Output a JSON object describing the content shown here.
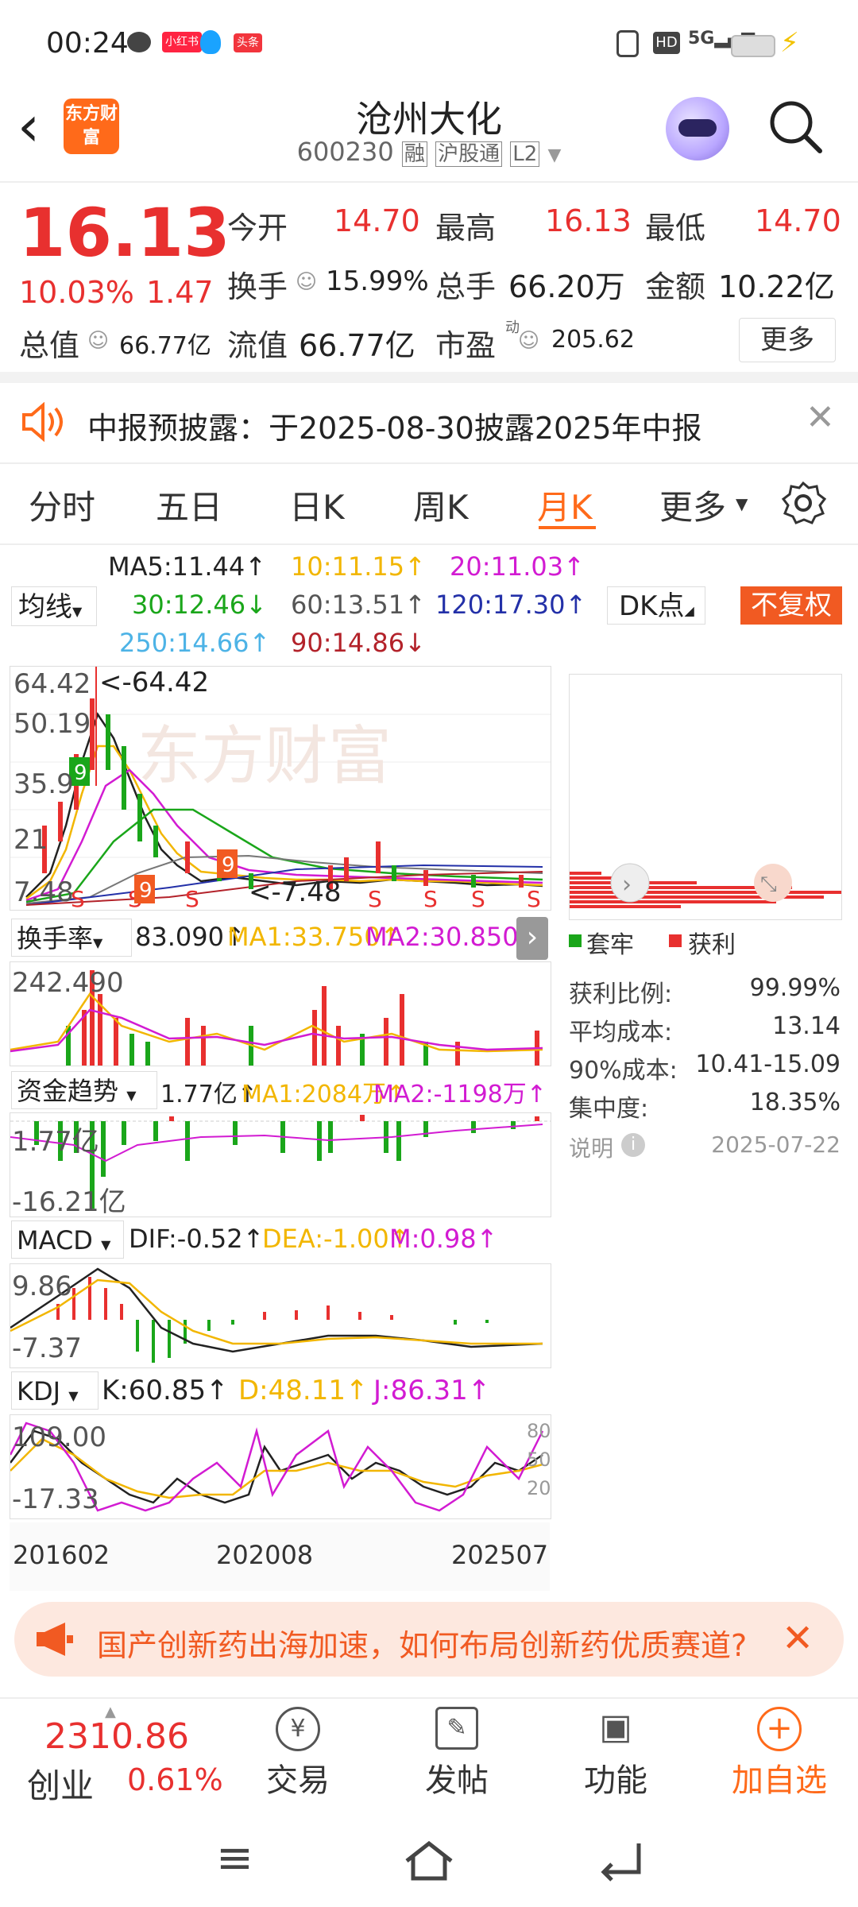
{
  "status": {
    "time": "00:24",
    "app_badges": [
      "小红书",
      "头条"
    ]
  },
  "header": {
    "title": "沧州大化",
    "code": "600230",
    "tags": [
      "融",
      "沪股通",
      "L2"
    ],
    "logo_text": "东方财富"
  },
  "quote": {
    "price": "16.13",
    "change_pct": "10.03%",
    "change": "1.47",
    "rows": [
      [
        {
          "label": "今开",
          "value": "14.70"
        },
        {
          "label": "最高",
          "value": "16.13"
        },
        {
          "label": "最低",
          "value": "14.70"
        }
      ],
      [
        {
          "label": "换手",
          "value": "15.99%"
        },
        {
          "label": "总手",
          "value": "66.20万"
        },
        {
          "label": "金额",
          "value": "10.22亿"
        }
      ],
      [
        {
          "label": "总值",
          "value": "66.77亿"
        },
        {
          "label": "流值",
          "value": "66.77亿"
        },
        {
          "label": "市盈",
          "value": "205.62",
          "sup": "动"
        }
      ]
    ],
    "more_label": "更多"
  },
  "notice": {
    "text": "中报预披露：于2025-08-30披露2025年中报"
  },
  "tabs": {
    "items": [
      "分时",
      "五日",
      "日K",
      "周K",
      "月K",
      "更多"
    ],
    "active": "月K"
  },
  "ma": {
    "selector": "均线",
    "ma5": "MA5:11.44↑",
    "ma10": "10:11.15↑",
    "ma20": "20:11.03↑",
    "ma30": "30:12.46↓",
    "ma60": "60:13.51↑",
    "ma120": "120:17.30↑",
    "ma250": "250:14.66↑",
    "ma90": "90:14.86↓",
    "dk": "DK点",
    "fq": "不复权"
  },
  "kline": {
    "y_top": "64.42",
    "y_2": "50.19",
    "y_3": "35.9",
    "y_4": "21",
    "y_bottom": "7.48",
    "high_mark": "<-64.42",
    "low_mark": "<-7.48"
  },
  "turnover": {
    "selector": "换手率",
    "value": "83.090↑",
    "ma1": "MA1:33.750↑",
    "ma2": "MA2:30.850↑",
    "y_top": "242.490"
  },
  "capital": {
    "selector": "资金趋势",
    "value": "1.77亿↑",
    "ma1": "MA1:2084万↑",
    "ma2": "MA2:-1198万↑",
    "y_top": "1.77亿",
    "y_bottom": "-16.21亿"
  },
  "macd": {
    "selector": "MACD",
    "dif": "DIF:-0.52↑",
    "dea": "DEA:-1.00↑",
    "m": "M:0.98↑",
    "y_top": "9.86",
    "y_bottom": "-7.37"
  },
  "kdj": {
    "selector": "KDJ",
    "k": "K:60.85↑",
    "d": "D:48.11↑",
    "j": "J:86.31↑",
    "y_top": "109.00",
    "y_bottom": "-17.33",
    "r80": "80",
    "r50": "50",
    "r20": "20"
  },
  "xaxis": {
    "left": "201602",
    "mid": "202008",
    "right": "202507"
  },
  "chips": {
    "legend_trapped": "套牢",
    "legend_profit": "获利",
    "rows": [
      {
        "label": "获利比例:",
        "value": "99.99%"
      },
      {
        "label": "平均成本:",
        "value": "13.14"
      },
      {
        "label": "90%成本:",
        "value": "10.41-15.09"
      },
      {
        "label": "集中度:",
        "value": "18.35%"
      }
    ],
    "note_label": "说明",
    "date": "2025-07-22"
  },
  "banner": {
    "text": "国产创新药出海加速，如何布局创新药优质赛道?"
  },
  "bottom_nav": {
    "index_value": "2310.86",
    "index_name": "创业",
    "index_change": "0.61%",
    "items": [
      {
        "label": "交易"
      },
      {
        "label": "发帖"
      },
      {
        "label": "功能"
      },
      {
        "label": "加自选"
      }
    ]
  },
  "colors": {
    "up": "#e8302f",
    "down": "#1aa61a",
    "accent": "#ff6a1a",
    "ma5": "#222222",
    "ma10": "#f2b600",
    "ma20": "#d21bd2",
    "ma30": "#1aa61a",
    "ma60": "#777777",
    "ma120": "#2330a8",
    "ma250": "#4db3e6",
    "ma90": "#b3222a"
  }
}
